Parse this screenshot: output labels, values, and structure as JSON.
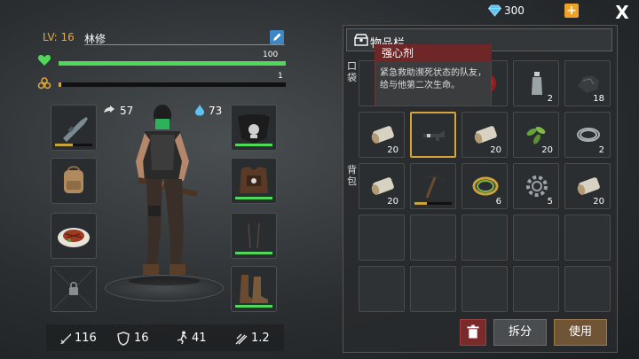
{
  "currency": {
    "gems": "300",
    "plus_label": "+",
    "close_label": "X"
  },
  "player": {
    "level_label": "LV: 16",
    "name": "林修",
    "hp_value": "100",
    "hp_fraction": 1.0,
    "radiation_value": "1",
    "radiation_fraction": 0.01,
    "stamina": "57",
    "water": "73"
  },
  "stats": {
    "attack": "116",
    "defense": "16",
    "speed": "41",
    "weight": "1.2"
  },
  "inventory": {
    "title": "物品栏",
    "pocket_label": "口袋",
    "backpack_label": "背包",
    "pocket_row1": [
      {
        "icon": "unknown-item",
        "count": ""
      },
      {
        "icon": "unknown-item",
        "count": ""
      },
      {
        "icon": "red-meat",
        "count": ""
      },
      {
        "icon": "plastic-bottle",
        "count": "2"
      },
      {
        "icon": "dark-stone",
        "count": "18"
      }
    ],
    "pocket_row2": [
      {
        "icon": "wood-log",
        "count": "20"
      },
      {
        "icon": "adrenaline-syringe",
        "count": ""
      },
      {
        "icon": "wood-log",
        "count": "20"
      },
      {
        "icon": "green-leaves",
        "count": "20"
      },
      {
        "icon": "wire-coil",
        "count": "2"
      }
    ],
    "backpack_row1": [
      {
        "icon": "wood-log",
        "count": "20"
      },
      {
        "icon": "pickaxe",
        "count": ""
      },
      {
        "icon": "rope",
        "count": "6"
      },
      {
        "icon": "gear",
        "count": "5"
      },
      {
        "icon": "wood-log",
        "count": "20"
      }
    ],
    "split_label": "拆分",
    "use_label": "使用"
  },
  "tooltip": {
    "title": "强心剂",
    "description": "紧急救助濒死状态的队友，给与他第二次生命。"
  },
  "colors": {
    "hp": "#4fd85a",
    "level": "#e0a94a",
    "tooltip_header": "#6e2626",
    "use_button": "#6f5535"
  }
}
